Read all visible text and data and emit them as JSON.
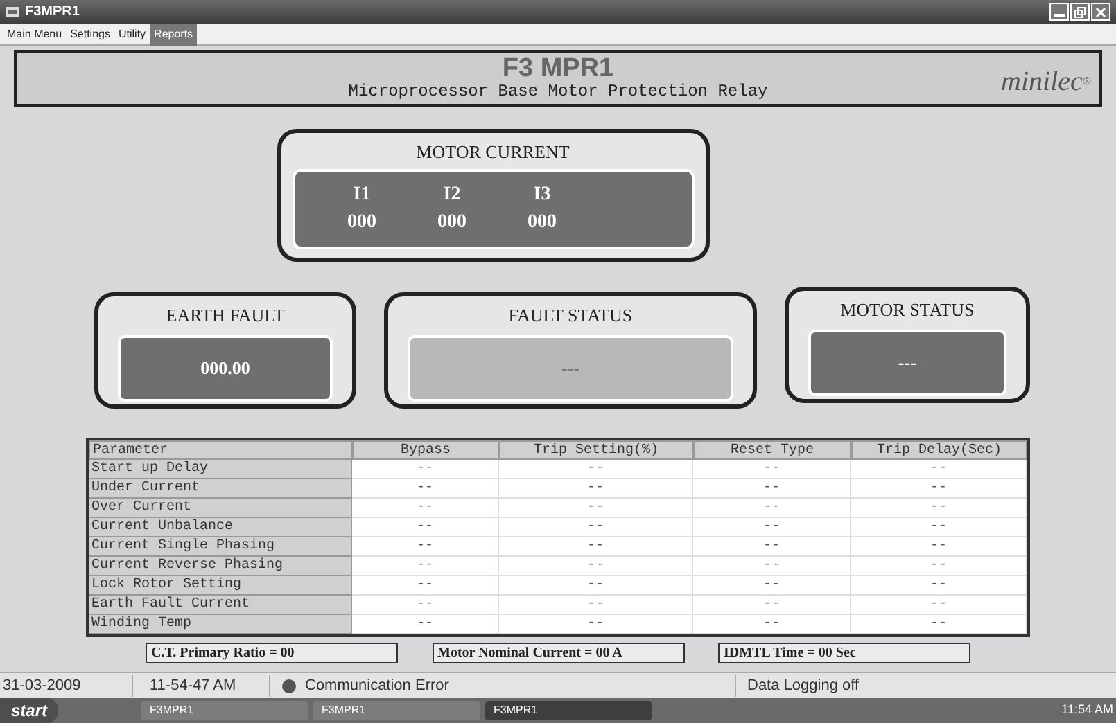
{
  "window": {
    "title": "F3MPR1"
  },
  "menu": [
    {
      "label": "Main Menu",
      "selected": false
    },
    {
      "label": "Settings",
      "selected": false
    },
    {
      "label": "Utility",
      "selected": false
    },
    {
      "label": "Reports",
      "selected": true
    }
  ],
  "header": {
    "title": "F3 MPR1",
    "subtitle": "Microprocessor Base Motor Protection Relay",
    "logo": "minilec",
    "logo_mark": "®"
  },
  "motor_current": {
    "title": "MOTOR CURRENT",
    "phases": [
      {
        "label": "I1",
        "value": "000"
      },
      {
        "label": "I2",
        "value": "000"
      },
      {
        "label": "I3",
        "value": "000"
      }
    ]
  },
  "panels": [
    {
      "title": "EARTH FAULT",
      "value": "000.00",
      "kind": "dark"
    },
    {
      "title": "FAULT STATUS",
      "value": "---",
      "kind": "light"
    },
    {
      "title": "MOTOR STATUS",
      "value": "---",
      "kind": "dark"
    }
  ],
  "table": {
    "columns": [
      "Parameter",
      "Bypass",
      "Trip Setting(%)",
      "Reset Type",
      "Trip Delay(Sec)"
    ],
    "rows": [
      [
        "Start up Delay",
        "--",
        "--",
        "--",
        "--"
      ],
      [
        "Under Current",
        "--",
        "--",
        "--",
        "--"
      ],
      [
        "Over Current",
        "--",
        "--",
        "--",
        "--"
      ],
      [
        "Current Unbalance",
        "--",
        "--",
        "--",
        "--"
      ],
      [
        "Current Single Phasing",
        "--",
        "--",
        "--",
        "--"
      ],
      [
        "Current Reverse Phasing",
        "--",
        "--",
        "--",
        "--"
      ],
      [
        "Lock Rotor Setting",
        "--",
        "--",
        "--",
        "--"
      ],
      [
        "Earth Fault Current",
        "--",
        "--",
        "--",
        "--"
      ],
      [
        "Winding Temp",
        "--",
        "--",
        "--",
        "--"
      ]
    ]
  },
  "summary": [
    "C.T. Primary Ratio = 00",
    "Motor Nominal Current = 00 A",
    "IDMTL Time = 00 Sec"
  ],
  "status_bar": {
    "date": "31-03-2009",
    "time": "11-54-47 AM",
    "communication": "Communication Error",
    "logging": "Data Logging off"
  },
  "taskbar": {
    "start": "start",
    "tasks": [
      {
        "label": "F3MPR1",
        "selected": false
      },
      {
        "label": "F3MPR1",
        "selected": false
      },
      {
        "label": "F3MPR1",
        "selected": true
      }
    ],
    "clock": "11:54 AM"
  }
}
